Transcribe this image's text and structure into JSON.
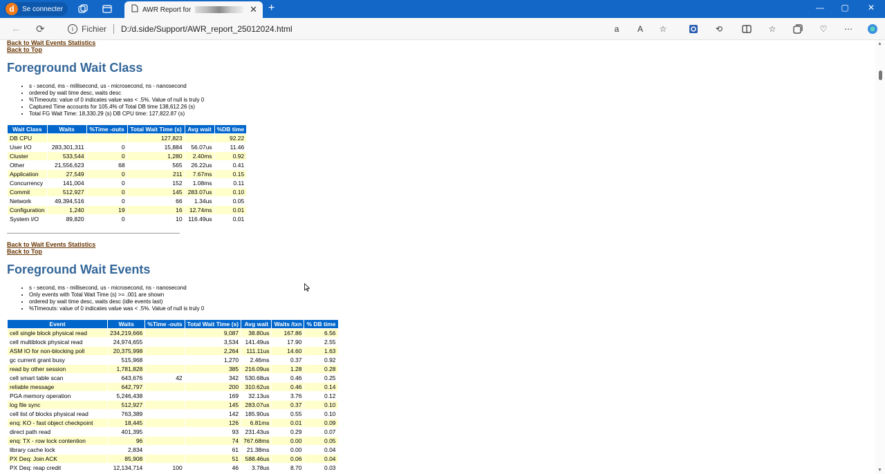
{
  "browser": {
    "profile_label": "Se connecter",
    "profile_initial": "d",
    "tab_title": "AWR Report for",
    "address_prefix": "Fichier",
    "url": "D:/d.side/Support/AWR_report_25012024.html"
  },
  "links": {
    "back_to_wait_events_statistics": "Back to Wait Events Statistics",
    "back_to_top": "Back to Top"
  },
  "wait_class": {
    "title": "Foreground Wait Class",
    "notes": [
      "s - second, ms - millisecond, us - microsecond, ns - nanosecond",
      "ordered by wait time desc, waits desc",
      "%Timeouts: value of 0 indicates value was < .5%. Value of null is truly 0",
      "Captured Time accounts for 105.4% of Total DB time 138,612.26 (s)",
      "Total FG Wait Time: 18,330.29 (s) DB CPU time: 127,822.87 (s)"
    ],
    "columns": [
      "Wait Class",
      "Waits",
      "%Time -outs",
      "Total Wait Time (s)",
      "Avg wait",
      "%DB time"
    ],
    "rows": [
      [
        "DB CPU",
        "",
        "",
        "127,823",
        "",
        "92.22"
      ],
      [
        "User I/O",
        "283,301,311",
        "0",
        "15,884",
        "56.07us",
        "11.46"
      ],
      [
        "Cluster",
        "533,544",
        "0",
        "1,280",
        "2.40ms",
        "0.92"
      ],
      [
        "Other",
        "21,556,623",
        "68",
        "565",
        "26.22us",
        "0.41"
      ],
      [
        "Application",
        "27,549",
        "0",
        "211",
        "7.67ms",
        "0.15"
      ],
      [
        "Concurrency",
        "141,004",
        "0",
        "152",
        "1.08ms",
        "0.11"
      ],
      [
        "Commit",
        "512,927",
        "0",
        "145",
        "283.07us",
        "0.10"
      ],
      [
        "Network",
        "49,394,516",
        "0",
        "66",
        "1.34us",
        "0.05"
      ],
      [
        "Configuration",
        "1,240",
        "19",
        "16",
        "12.74ms",
        "0.01"
      ],
      [
        "System I/O",
        "89,820",
        "0",
        "10",
        "116.49us",
        "0.01"
      ]
    ]
  },
  "wait_events": {
    "title": "Foreground Wait Events",
    "notes": [
      "s - second, ms - millisecond, us - microsecond, ns - nanosecond",
      "Only events with Total Wait Time (s) >= .001 are shown",
      "ordered by wait time desc, waits desc (idle events last)",
      "%Timeouts: value of 0 indicates value was < .5%. Value of null is truly 0"
    ],
    "columns": [
      "Event",
      "Waits",
      "%Time -outs",
      "Total Wait Time (s)",
      "Avg wait",
      "Waits /txn",
      "% DB time"
    ],
    "rows": [
      [
        "cell single block physical read",
        "234,219,666",
        "",
        "9,087",
        "38.80us",
        "167.86",
        "6.56"
      ],
      [
        "cell multiblock physical read",
        "24,974,655",
        "",
        "3,534",
        "141.49us",
        "17.90",
        "2.55"
      ],
      [
        "ASM IO for non-blocking poll",
        "20,375,998",
        "",
        "2,264",
        "111.11us",
        "14.60",
        "1.63"
      ],
      [
        "gc current grant busy",
        "515,968",
        "",
        "1,270",
        "2.46ms",
        "0.37",
        "0.92"
      ],
      [
        "read by other session",
        "1,781,828",
        "",
        "385",
        "216.09us",
        "1.28",
        "0.28"
      ],
      [
        "cell smart table scan",
        "643,676",
        "42",
        "342",
        "530.68us",
        "0.46",
        "0.25"
      ],
      [
        "reliable message",
        "642,797",
        "",
        "200",
        "310.62us",
        "0.46",
        "0.14"
      ],
      [
        "PGA memory operation",
        "5,246,438",
        "",
        "169",
        "32.13us",
        "3.76",
        "0.12"
      ],
      [
        "log file sync",
        "512,927",
        "",
        "145",
        "283.07us",
        "0.37",
        "0.10"
      ],
      [
        "cell list of blocks physical read",
        "763,389",
        "",
        "142",
        "185.90us",
        "0.55",
        "0.10"
      ],
      [
        "enq: KO - fast object checkpoint",
        "18,445",
        "",
        "126",
        "6.81ms",
        "0.01",
        "0.09"
      ],
      [
        "direct path read",
        "401,395",
        "",
        "93",
        "231.43us",
        "0.29",
        "0.07"
      ],
      [
        "enq: TX - row lock contention",
        "96",
        "",
        "74",
        "767.68ms",
        "0.00",
        "0.05"
      ],
      [
        "library cache lock",
        "2,834",
        "",
        "61",
        "21.38ms",
        "0.00",
        "0.04"
      ],
      [
        "PX Deq: Join ACK",
        "85,908",
        "",
        "51",
        "588.46us",
        "0.06",
        "0.04"
      ],
      [
        "PX Deq: reap credit",
        "12,134,714",
        "100",
        "46",
        "3.78us",
        "8.70",
        "0.03"
      ]
    ]
  }
}
